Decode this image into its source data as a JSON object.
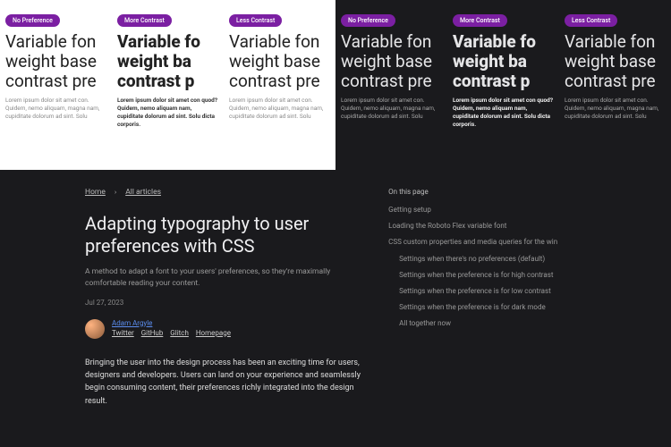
{
  "demo": {
    "pills": [
      "No Preference",
      "More Contrast",
      "Less Contrast",
      "No Preference",
      "More Contrast",
      "Less Contrast"
    ],
    "heading_line1": "Variable fon",
    "heading_line2": "weight base",
    "heading_line3": "contrast pre",
    "heading_bold_line1": "Variable fo",
    "heading_bold_line2": "weight ba",
    "heading_bold_line3": "contrast p",
    "lorem_normal": "Lorem ipsum dolor sit amet con. Quidem, nemo aliquam, magna nam, cupiditate dolorum ad sint. Solu",
    "lorem_bold": "Lorem ipsum dolor sit amet con quod? Quidem, nemo aliquam nam, cupiditate dolorum ad sint. Solu dicta corporis."
  },
  "breadcrumb": {
    "home": "Home",
    "all": "All articles"
  },
  "article": {
    "title": "Adapting typography to user preferences with CSS",
    "subtitle": "A method to adapt a font to your users' preferences, so they're maximally comfortable reading your content.",
    "date": "Jul 27, 2023",
    "author_name": "Adam Argyle",
    "author_links": {
      "twitter": "Twitter",
      "github": "GitHub",
      "glitch": "Glitch",
      "homepage": "Homepage"
    },
    "body": "Bringing the user into the design process has been an exciting time for users, designers and developers. Users can land on your experience and seamlessly begin consuming content, their preferences richly integrated into the design result."
  },
  "toc": {
    "title": "On this page",
    "items": [
      {
        "label": "Getting setup",
        "sub": false
      },
      {
        "label": "Loading the Roboto Flex variable font",
        "sub": false
      },
      {
        "label": "CSS custom properties and media queries for the win",
        "sub": false
      },
      {
        "label": "Settings when there's no preferences (default)",
        "sub": true
      },
      {
        "label": "Settings when the preference is for high contrast",
        "sub": true
      },
      {
        "label": "Settings when the preference is for low contrast",
        "sub": true
      },
      {
        "label": "Settings when the preference is for dark mode",
        "sub": true
      },
      {
        "label": "All together now",
        "sub": true
      }
    ]
  }
}
